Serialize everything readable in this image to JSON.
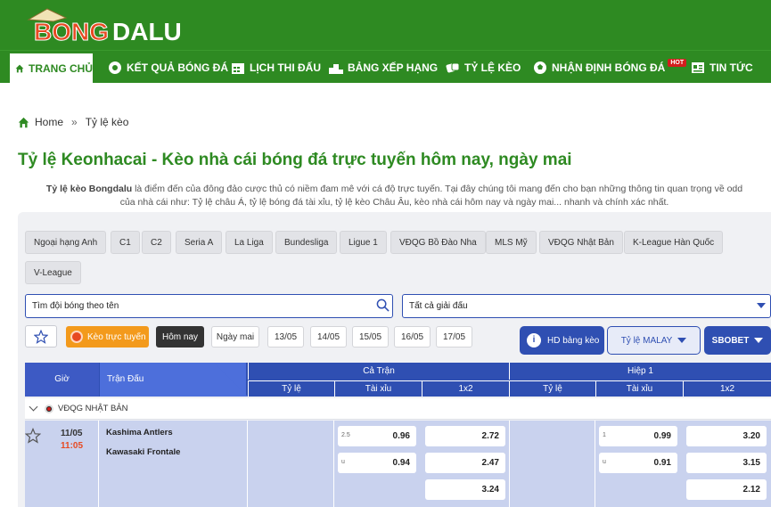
{
  "brand": {
    "logo_part1": "BONG",
    "logo_part2": "DALU",
    "primary_color": "#2e8a22",
    "accent_color": "#2f4fb2",
    "logo_color": "#e74a22"
  },
  "nav": {
    "items": [
      {
        "label": "TRANG CHỦ",
        "icon": "home-icon",
        "active": true
      },
      {
        "label": "KẾT QUẢ BÓNG ĐÁ",
        "icon": "ball-icon"
      },
      {
        "label": "LỊCH THI ĐẤU",
        "icon": "calendar-icon"
      },
      {
        "label": "BẢNG XẾP HẠNG",
        "icon": "podium-icon"
      },
      {
        "label": "TỶ LỆ KÈO",
        "icon": "odds-icon"
      },
      {
        "label": "NHẬN ĐỊNH BÓNG ĐÁ",
        "icon": "football-icon",
        "badge": "HOT"
      },
      {
        "label": "TIN TỨC",
        "icon": "news-icon"
      }
    ]
  },
  "breadcrumb": {
    "home": "Home",
    "separator": "»",
    "current": "Tỷ lệ kèo"
  },
  "page": {
    "title": "Tỷ lệ Keonhacai - Kèo nhà cái bóng đá trực tuyến hôm nay, ngày mai",
    "intro_bold": "Tỷ lệ kèo Bongdalu",
    "intro_line1": " là điểm đến của đông đảo cược thủ có niềm đam mê với cá độ trực tuyến. Tại đây chúng tôi mang đến cho bạn những thông tin quan trọng về odd",
    "intro_line2": "của nhà cái như: Tỷ lệ châu Á, tỷ lệ bóng đá tài xỉu, tỷ lệ kèo Châu Âu, kèo nhà cái hôm nay và ngày mai... nhanh và chính xác nhất."
  },
  "leagues": [
    "Ngoại hạng Anh",
    "C1",
    "C2",
    "Seria A",
    "La Liga",
    "Bundesliga",
    "Ligue 1",
    "VĐQG Bồ Đào Nha",
    "MLS Mỹ",
    "VĐQG Nhật Bản",
    "K-League Hàn Quốc",
    "V-League"
  ],
  "filters": {
    "search_placeholder": "Tìm đội bóng theo tên",
    "league_select": "Tất cả giải đấu",
    "live_label": "Kèo trực tuyến",
    "days": [
      "Hôm nay",
      "Ngày mai",
      "13/05",
      "14/05",
      "15/05",
      "16/05",
      "17/05"
    ],
    "selected_day": "Hôm nay",
    "hd_label": "HD bảng kèo",
    "odds_format": "Tỷ lệ MALAY",
    "bookmaker": "SBOBET"
  },
  "table": {
    "col_time": "Giờ",
    "col_match": "Trận Đấu",
    "group_full": "Cả Trận",
    "group_half": "Hiệp 1",
    "sub_cols": [
      "Tỷ lệ",
      "Tài xỉu",
      "1x2",
      "Tỷ lệ",
      "Tài xỉu",
      "1x2"
    ]
  },
  "league_group": {
    "name": "VĐQG NHẬT BẢN"
  },
  "match": {
    "date": "11/05",
    "time": "11:05",
    "home": "Kashima Antlers",
    "away": "Kawasaki Frontale",
    "ft_ou": [
      {
        "line": "2.5",
        "odd": "0.96"
      },
      {
        "line": "u",
        "odd": "0.94"
      }
    ],
    "ft_1x2": [
      "2.72",
      "2.47",
      "3.24"
    ],
    "h1_ou": [
      {
        "line": "1",
        "odd": "0.99"
      },
      {
        "line": "u",
        "odd": "0.91"
      }
    ],
    "h1_1x2": [
      "3.20",
      "3.15",
      "2.12"
    ]
  }
}
